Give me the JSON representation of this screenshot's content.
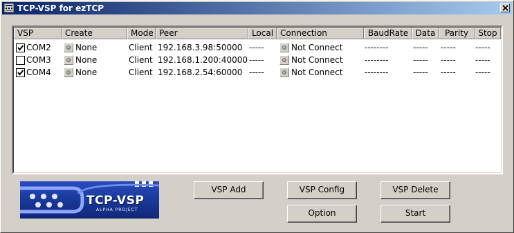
{
  "window": {
    "title": "TCP-VSP for ezTCP",
    "close_glyph": "✕"
  },
  "columns": [
    "VSP",
    "Create",
    "Mode",
    "Peer",
    "Local",
    "Connection",
    "BaudRate",
    "Data",
    "Parity",
    "Stop"
  ],
  "rows": [
    {
      "checked": true,
      "vsp": "COM2",
      "create": "None",
      "mode": "Client",
      "peer": "192.168.3.98:50000",
      "local": "-----",
      "connection": "Not Connect",
      "baudrate": "--------",
      "data": "-----",
      "parity": "-----",
      "stop": "-----"
    },
    {
      "checked": false,
      "vsp": "COM3",
      "create": "None",
      "mode": "Client",
      "peer": "192.168.1.200:40000",
      "local": "-----",
      "connection": "Not Connect",
      "baudrate": "--------",
      "data": "-----",
      "parity": "-----",
      "stop": "-----"
    },
    {
      "checked": true,
      "vsp": "COM4",
      "create": "None",
      "mode": "Client",
      "peer": "192.168.2.54:60000",
      "local": "-----",
      "connection": "Not Connect",
      "baudrate": "--------",
      "data": "-----",
      "parity": "-----",
      "stop": "-----"
    }
  ],
  "logo": {
    "title": "TCP-VSP",
    "subtitle": "ALPHA PROJECT"
  },
  "buttons": {
    "vsp_add": "VSP Add",
    "vsp_config": "VSP Config",
    "vsp_delete": "VSP Delete",
    "option": "Option",
    "start": "Start"
  },
  "colors": {
    "titlebar_start": "#0a246a",
    "titlebar_end": "#a6caf0",
    "face": "#d4d0c8",
    "logo_blue": "#1a3a9c"
  }
}
